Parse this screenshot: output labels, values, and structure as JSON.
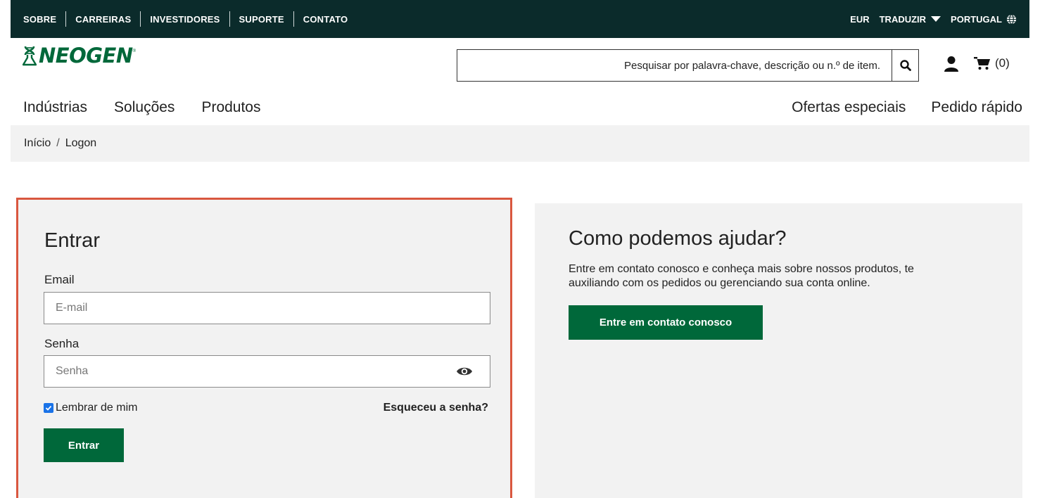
{
  "topbar": {
    "links": [
      "SOBRE",
      "CARREIRAS",
      "INVESTIDORES",
      "SUPORTE",
      "CONTATO"
    ],
    "currency": "EUR",
    "translate": "TRADUZIR",
    "region": "PORTUGAL"
  },
  "header": {
    "logo_text": "NEOGEN",
    "logo_mark": "®",
    "search_placeholder": "Pesquisar por palavra-chave, descrição ou n.º de item.",
    "cart_count": "(0)"
  },
  "mainnav": {
    "left": [
      "Indústrias",
      "Soluções",
      "Produtos"
    ],
    "right": [
      "Ofertas especiais",
      "Pedido rápido"
    ]
  },
  "breadcrumb": {
    "home": "Início",
    "separator": "/",
    "current": "Logon"
  },
  "login": {
    "title": "Entrar",
    "email_label": "Email",
    "email_placeholder": "E-mail",
    "password_label": "Senha",
    "password_placeholder": "Senha",
    "remember_label": "Lembrar de mim",
    "remember_checked": true,
    "forgot_label": "Esqueceu a senha?",
    "submit_label": "Entrar"
  },
  "help": {
    "title": "Como podemos ajudar?",
    "text": "Entre em contato conosco e conheça mais sobre nossos produtos, te auxiliando com os pedidos ou gerenciando sua conta online.",
    "button_label": "Entre em contato conosco"
  },
  "colors": {
    "topbar_bg": "#0b2b2b",
    "brand_green": "#00683a",
    "highlight_border": "#d9573f",
    "panel_bg": "#f2f2f2"
  },
  "icons": [
    "globe-icon",
    "caret-down-icon",
    "search-icon",
    "user-icon",
    "cart-icon",
    "eye-icon",
    "checkbox-icon",
    "logo-dna-icon"
  ]
}
